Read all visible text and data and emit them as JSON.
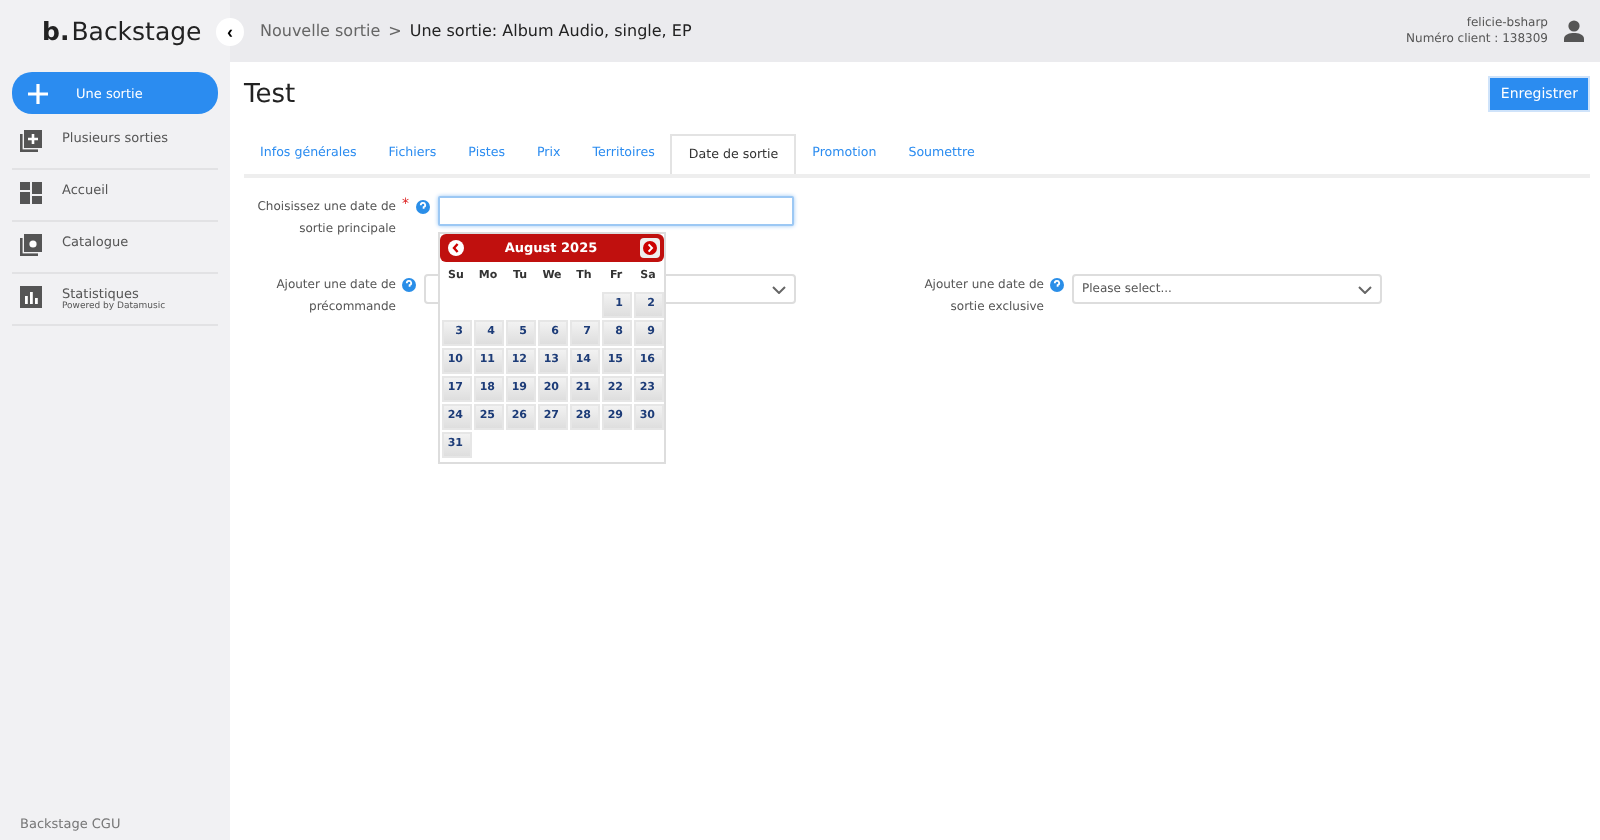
{
  "brand": {
    "mark": "b.",
    "name": "Backstage"
  },
  "breadcrumb": {
    "back": "‹",
    "parent": "Nouvelle sortie",
    "separator": ">",
    "current": "Une sortie: Album Audio, single, EP"
  },
  "user": {
    "name": "felicie-bsharp",
    "client": "Numéro client : 138309"
  },
  "sidebar": {
    "items": [
      {
        "label": "Une sortie",
        "kind": "primary"
      },
      {
        "label": "Plusieurs sorties",
        "kind": "link"
      },
      {
        "label": "Accueil",
        "kind": "link"
      },
      {
        "label": "Catalogue",
        "kind": "link"
      },
      {
        "label": "Statistiques",
        "sub": "Powered by Datamusic",
        "kind": "link"
      }
    ],
    "footer": "Backstage CGU"
  },
  "page": {
    "title": "Test",
    "save": "Enregistrer"
  },
  "tabs": [
    {
      "label": "Infos générales",
      "selected": false
    },
    {
      "label": "Fichiers",
      "selected": false
    },
    {
      "label": "Pistes",
      "selected": false
    },
    {
      "label": "Prix",
      "selected": false
    },
    {
      "label": "Territoires",
      "selected": false
    },
    {
      "label": "Date de sortie",
      "selected": true
    },
    {
      "label": "Promotion",
      "selected": false
    },
    {
      "label": "Soumettre",
      "selected": false
    }
  ],
  "form": {
    "main_date": {
      "label": "Choisissez une date de sortie principale",
      "required": true,
      "required_mark": "*"
    },
    "preorder": {
      "label": "Ajouter une date de précommande"
    },
    "exclusive": {
      "label": "Ajouter une date de sortie exclusive",
      "placeholder": "Please select..."
    }
  },
  "calendar": {
    "month": "August 2025",
    "weekdays": [
      "Su",
      "Mo",
      "Tu",
      "We",
      "Th",
      "Fr",
      "Sa"
    ],
    "weeks": [
      [
        "1",
        "2"
      ],
      [
        "3",
        "4",
        "5",
        "6",
        "7",
        "8",
        "9"
      ],
      [
        "10",
        "11",
        "12",
        "13",
        "14",
        "15",
        "16"
      ],
      [
        "17",
        "18",
        "19",
        "20",
        "21",
        "22",
        "23"
      ],
      [
        "24",
        "25",
        "26",
        "27",
        "28",
        "29",
        "30"
      ],
      [
        "31"
      ]
    ]
  }
}
